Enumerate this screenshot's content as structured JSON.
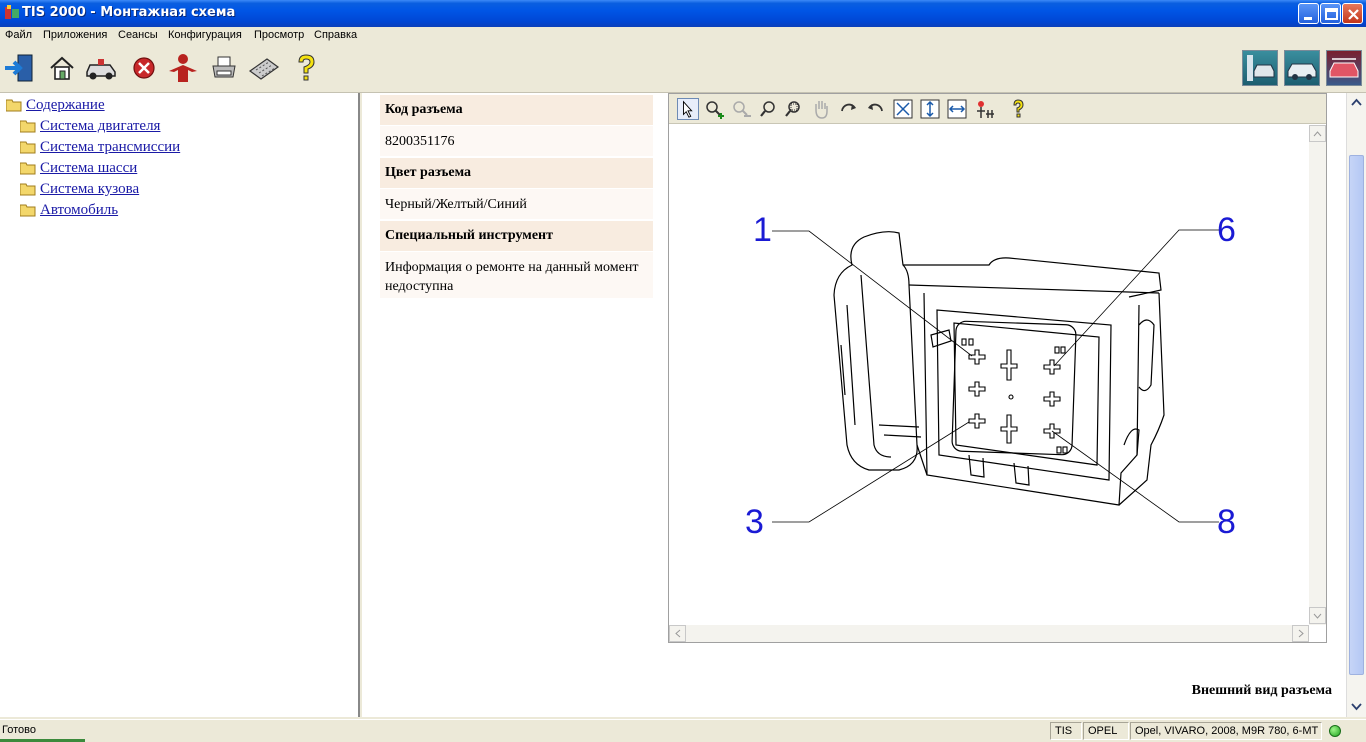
{
  "window": {
    "title": "TIS 2000 - Монтажная схема"
  },
  "menu": {
    "items": [
      {
        "label": "Файл"
      },
      {
        "label": "Приложения"
      },
      {
        "label": "Сеансы"
      },
      {
        "label": "Конфигурация"
      },
      {
        "label": "Просмотр"
      },
      {
        "label": "Справка"
      }
    ]
  },
  "toolbar": {
    "left_icons": [
      "exit-icon",
      "home-icon",
      "vehicle-icon",
      "stop-icon",
      "person-icon",
      "print-icon",
      "keyboard-icon",
      "help-icon"
    ],
    "right_icons": [
      "vehicle-diagnostics-icon",
      "vehicle-service-icon",
      "vehicle-wiring-icon"
    ]
  },
  "tree": {
    "root": "Содержание",
    "items": [
      {
        "label": "Система двигателя"
      },
      {
        "label": "Система трансмиссии"
      },
      {
        "label": "Система шасси"
      },
      {
        "label": "Система кузова"
      },
      {
        "label": "Автомобиль"
      }
    ]
  },
  "info": {
    "code_header": "Код разъема",
    "code_value": "8200351176",
    "color_header": "Цвет разъема",
    "color_value": "Черный/Желтый/Синий",
    "tool_header": "Специальный инструмент",
    "tool_value": "Информация о ремонте на данный момент недоступна"
  },
  "viewer": {
    "tools": [
      "select-pointer-icon",
      "zoom-in-icon",
      "zoom-out-icon",
      "zoom-icon",
      "zoom-window-icon",
      "pan-hand-icon",
      "rotate-cw-icon",
      "rotate-ccw-icon",
      "fit-all-icon",
      "fit-height-icon",
      "fit-width-icon",
      "highlight-icon",
      "help-icon"
    ],
    "callouts": {
      "c1": "1",
      "c3": "3",
      "c6": "6",
      "c8": "8"
    },
    "callout_color": "#1a1ad4"
  },
  "caption": "Внешний вид разъема",
  "status": {
    "ready": "Готово",
    "system": "TIS",
    "brand": "OPEL",
    "vehicle": "Opel, VIVARO, 2008, M9R 780, 6-MT"
  }
}
